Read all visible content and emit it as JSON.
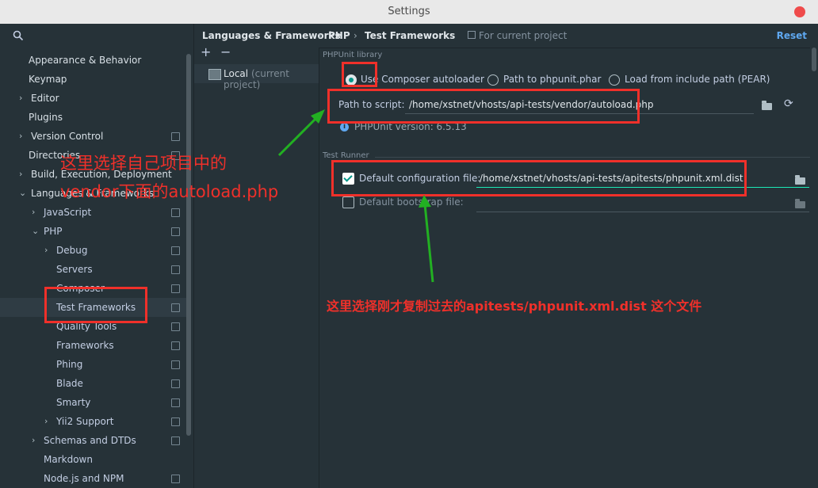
{
  "window": {
    "title": "Settings"
  },
  "search": {
    "icon": "search-icon"
  },
  "tree": [
    {
      "label": "Appearance & Behavior",
      "level": 0,
      "arrow": "",
      "cfg": false,
      "bold": true
    },
    {
      "label": "Keymap",
      "level": 0,
      "arrow": "",
      "cfg": false,
      "bold": true
    },
    {
      "label": "Editor",
      "level": 0,
      "arrow": "›",
      "cfg": false,
      "bold": true
    },
    {
      "label": "Plugins",
      "level": 0,
      "arrow": "",
      "cfg": false,
      "bold": true
    },
    {
      "label": "Version Control",
      "level": 0,
      "arrow": "›",
      "cfg": true,
      "bold": true
    },
    {
      "label": "Directories",
      "level": 0,
      "arrow": "",
      "cfg": true,
      "bold": true
    },
    {
      "label": "Build, Execution, Deployment",
      "level": 0,
      "arrow": "›",
      "cfg": false,
      "bold": true
    },
    {
      "label": "Languages & Frameworks",
      "level": 0,
      "arrow": "⌄",
      "cfg": false,
      "bold": true
    },
    {
      "label": "JavaScript",
      "level": 1,
      "arrow": "›",
      "cfg": true,
      "bold": false
    },
    {
      "label": "PHP",
      "level": 1,
      "arrow": "⌄",
      "cfg": true,
      "bold": false
    },
    {
      "label": "Debug",
      "level": 2,
      "arrow": "›",
      "cfg": true,
      "bold": false
    },
    {
      "label": "Servers",
      "level": 2,
      "arrow": "",
      "cfg": true,
      "bold": false
    },
    {
      "label": "Composer",
      "level": 2,
      "arrow": "",
      "cfg": true,
      "bold": false
    },
    {
      "label": "Test Frameworks",
      "level": 2,
      "arrow": "",
      "cfg": true,
      "bold": false,
      "selected": true
    },
    {
      "label": "Quality Tools",
      "level": 2,
      "arrow": "",
      "cfg": true,
      "bold": false
    },
    {
      "label": "Frameworks",
      "level": 2,
      "arrow": "",
      "cfg": true,
      "bold": false
    },
    {
      "label": "Phing",
      "level": 2,
      "arrow": "",
      "cfg": true,
      "bold": false
    },
    {
      "label": "Blade",
      "level": 2,
      "arrow": "",
      "cfg": true,
      "bold": false
    },
    {
      "label": "Smarty",
      "level": 2,
      "arrow": "",
      "cfg": true,
      "bold": false
    },
    {
      "label": "Yii2 Support",
      "level": 2,
      "arrow": "›",
      "cfg": true,
      "bold": false
    },
    {
      "label": "Schemas and DTDs",
      "level": 1,
      "arrow": "›",
      "cfg": true,
      "bold": false
    },
    {
      "label": "Markdown",
      "level": 1,
      "arrow": "",
      "cfg": false,
      "bold": false
    },
    {
      "label": "Node.js and NPM",
      "level": 1,
      "arrow": "",
      "cfg": true,
      "bold": false
    }
  ],
  "breadcrumb": {
    "part1": "Languages & Frameworks",
    "part2": "PHP",
    "part3": "Test Frameworks",
    "separator": "›"
  },
  "header": {
    "project_scope": "For current project",
    "reset_label": "Reset"
  },
  "list_toolbar": {
    "add": "+",
    "remove": "−"
  },
  "interpreter": {
    "name": "Local",
    "note": "(current project)"
  },
  "phpunit": {
    "section_title": "PHPUnit library",
    "options": [
      "Use Composer autoloader",
      "Path to phpunit.phar",
      "Load from include path (PEAR)"
    ],
    "selected_index": 0,
    "path_label": "Path to script:",
    "path_value": "/home/xstnet/vhosts/api-tests/vendor/autoload.php",
    "version_text": "PHPUnit version: 6.5.13"
  },
  "test_runner": {
    "section_title": "Test Runner",
    "config_label": "Default configuration file:",
    "config_checked": true,
    "config_value": "/home/xstnet/vhosts/api-tests/apitests/phpunit.xml.dist",
    "bootstrap_label": "Default bootstrap file:",
    "bootstrap_checked": false,
    "bootstrap_value": ""
  },
  "annotations": {
    "left_line1": "这里选择自己项目中的",
    "left_line2": "vendor下面的autoload.php",
    "bottom": "这里选择刚才复制过去的apitests/phpunit.xml.dist 这个文件",
    "color": "#f0302a",
    "arrow_color": "#22b022"
  }
}
